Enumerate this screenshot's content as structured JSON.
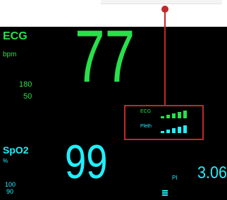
{
  "monitor": {
    "ecg": {
      "title": "ECG",
      "unit": "bpm",
      "alarm_high": "180",
      "alarm_low": "50",
      "heart_rate": "77"
    },
    "signal_indicator": {
      "ecg_label": "ECG",
      "pleth_label": "Pleth",
      "ecg_level_fraction": 1.0,
      "pleth_level_fraction": 1.0
    },
    "spo2": {
      "title": "SpO2",
      "unit": "%",
      "alarm_high": "100",
      "alarm_low": "90",
      "value": "99"
    },
    "pi": {
      "label": "PI",
      "value": "3.06"
    }
  },
  "colors": {
    "ecg": "#27e14a",
    "spo2": "#1ff0ff",
    "callout": "#c0282c",
    "background": "#000000"
  },
  "icons": [
    "menu-icon"
  ]
}
